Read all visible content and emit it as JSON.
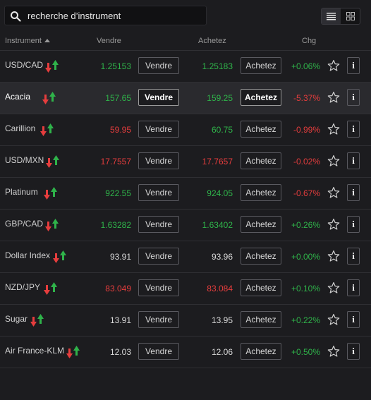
{
  "search": {
    "placeholder": "recherche d’instrument",
    "value": ""
  },
  "view_toggle": {
    "list_icon": "list-icon",
    "grid_icon": "grid-icon",
    "active": "list"
  },
  "header": {
    "instrument": "Instrument",
    "sell": "Vendre",
    "buy": "Achetez",
    "change": "Chg"
  },
  "colors": {
    "up": "#2fb34a",
    "down": "#e63d3d",
    "neutral": "#d9d9d9",
    "background": "#1c1c1f"
  },
  "rows": [
    {
      "name": "USD/CAD",
      "sell": "1.25153",
      "sell_color": "green",
      "buy": "1.25183",
      "buy_color": "green",
      "sell_label": "Vendre",
      "buy_label": "Achetez",
      "chg": "+0.06%",
      "chg_color": "green",
      "selected": false
    },
    {
      "name": "Acacia",
      "sell": "157.65",
      "sell_color": "green",
      "buy": "159.25",
      "buy_color": "green",
      "sell_label": "Vendre",
      "buy_label": "Achetez",
      "chg": "-5.37%",
      "chg_color": "red",
      "selected": true
    },
    {
      "name": "Carillion",
      "sell": "59.95",
      "sell_color": "red",
      "buy": "60.75",
      "buy_color": "green",
      "sell_label": "Vendre",
      "buy_label": "Achetez",
      "chg": "-0.99%",
      "chg_color": "red",
      "selected": false
    },
    {
      "name": "USD/MXN",
      "sell": "17.7557",
      "sell_color": "red",
      "buy": "17.7657",
      "buy_color": "red",
      "sell_label": "Vendre",
      "buy_label": "Achetez",
      "chg": "-0.02%",
      "chg_color": "red",
      "selected": false
    },
    {
      "name": "Platinum",
      "sell": "922.55",
      "sell_color": "green",
      "buy": "924.05",
      "buy_color": "green",
      "sell_label": "Vendre",
      "buy_label": "Achetez",
      "chg": "-0.67%",
      "chg_color": "red",
      "selected": false
    },
    {
      "name": "GBP/CAD",
      "sell": "1.63282",
      "sell_color": "green",
      "buy": "1.63402",
      "buy_color": "green",
      "sell_label": "Vendre",
      "buy_label": "Achetez",
      "chg": "+0.26%",
      "chg_color": "green",
      "selected": false
    },
    {
      "name": "Dollar Index",
      "sell": "93.91",
      "sell_color": "neutral",
      "buy": "93.96",
      "buy_color": "neutral",
      "sell_label": "Vendre",
      "buy_label": "Achetez",
      "chg": "+0.00%",
      "chg_color": "green",
      "selected": false
    },
    {
      "name": "NZD/JPY",
      "sell": "83.049",
      "sell_color": "red",
      "buy": "83.084",
      "buy_color": "red",
      "sell_label": "Vendre",
      "buy_label": "Achetez",
      "chg": "+0.10%",
      "chg_color": "green",
      "selected": false
    },
    {
      "name": "Sugar",
      "sell": "13.91",
      "sell_color": "neutral",
      "buy": "13.95",
      "buy_color": "neutral",
      "sell_label": "Vendre",
      "buy_label": "Achetez",
      "chg": "+0.22%",
      "chg_color": "green",
      "selected": false
    },
    {
      "name": "Air France-KLM",
      "sell": "12.03",
      "sell_color": "neutral",
      "buy": "12.06",
      "buy_color": "neutral",
      "sell_label": "Vendre",
      "buy_label": "Achetez",
      "chg": "+0.50%",
      "chg_color": "green",
      "selected": false
    }
  ],
  "row_icons": {
    "trend": "up-down-arrows-icon",
    "favorite": "star-icon",
    "info": "info-icon",
    "info_glyph": "i"
  }
}
